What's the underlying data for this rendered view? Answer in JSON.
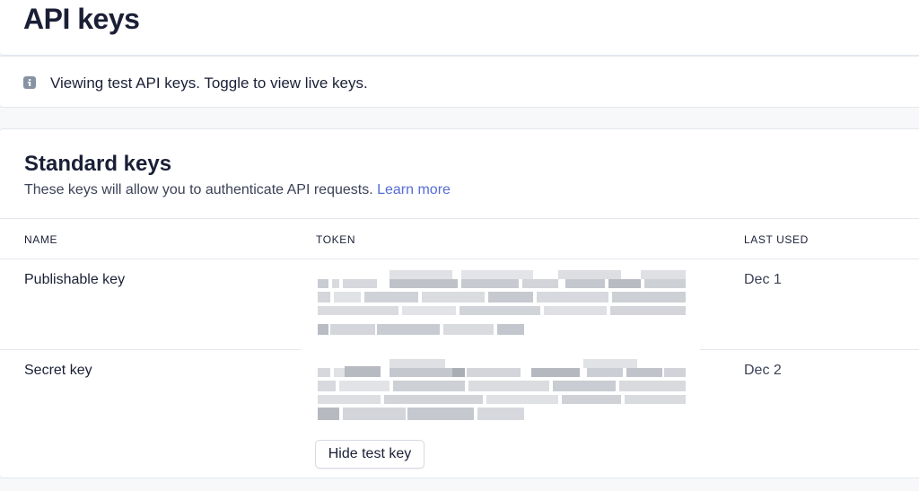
{
  "header": {
    "title": "API keys"
  },
  "notice": {
    "icon": "info-icon",
    "text": "Viewing test API keys. Toggle to view live keys."
  },
  "standard_keys": {
    "title": "Standard keys",
    "description": "These keys will allow you to authenticate API requests.",
    "learn_more": "Learn more",
    "columns": [
      "NAME",
      "TOKEN",
      "LAST USED"
    ],
    "rows": [
      {
        "name": "Publishable key",
        "last_used": "Dec 1"
      },
      {
        "name": "Secret key",
        "last_used": "Dec 2"
      }
    ],
    "hide_button": "Hide test key"
  },
  "colors": {
    "accent": "#556cd6",
    "text": "#1a1f36",
    "border": "#e3e8ee"
  }
}
